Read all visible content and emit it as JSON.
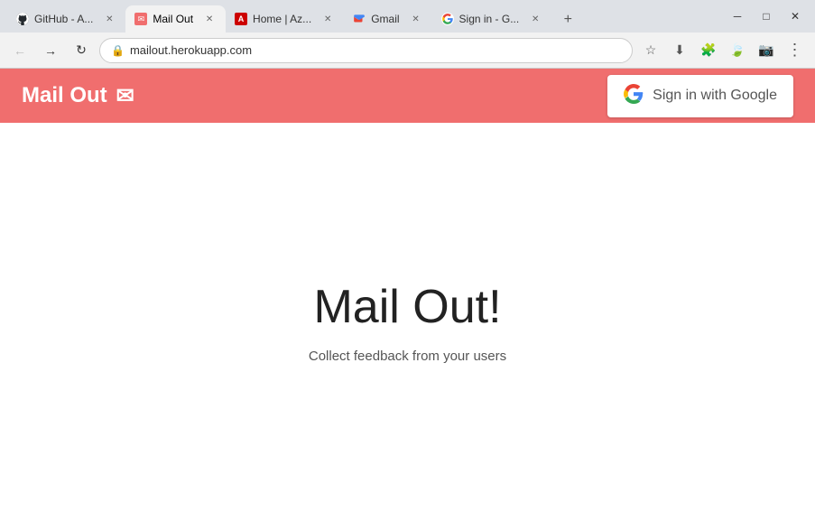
{
  "browser": {
    "tabs": [
      {
        "id": "github",
        "label": "GitHub - A...",
        "active": false,
        "favicon_color": "#24292e",
        "favicon_symbol": "🐙"
      },
      {
        "id": "mailout",
        "label": "Mail Out",
        "active": true,
        "favicon_color": "#f06e6e",
        "favicon_symbol": "✉"
      },
      {
        "id": "home-az",
        "label": "Home | Az...",
        "active": false,
        "favicon_color": "#c00",
        "favicon_symbol": "A"
      },
      {
        "id": "gmail",
        "label": "Gmail",
        "active": false,
        "favicon_color": "#ea4335",
        "favicon_symbol": "M"
      },
      {
        "id": "signin",
        "label": "Sign in - G...",
        "active": false,
        "favicon_color": "#4285f4",
        "favicon_symbol": "G"
      }
    ],
    "url": "mailout.herokuapp.com",
    "new_tab_label": "+",
    "window_controls": {
      "minimize": "─",
      "maximize": "□",
      "close": "✕"
    }
  },
  "app": {
    "header": {
      "title": "Mail Out",
      "mail_icon": "✉",
      "sign_in_button": "Sign in with Google"
    },
    "hero": {
      "title": "Mail Out!",
      "subtitle": "Collect feedback from your users"
    }
  },
  "toolbar": {
    "back_icon": "←",
    "forward_icon": "→",
    "reload_icon": "↻",
    "lock_icon": "🔒",
    "star_icon": "☆",
    "download_icon": "⬇",
    "extensions_icon": "🧩",
    "leaf_icon": "🍃",
    "video_icon": "📷",
    "menu_icon": "⋮"
  }
}
